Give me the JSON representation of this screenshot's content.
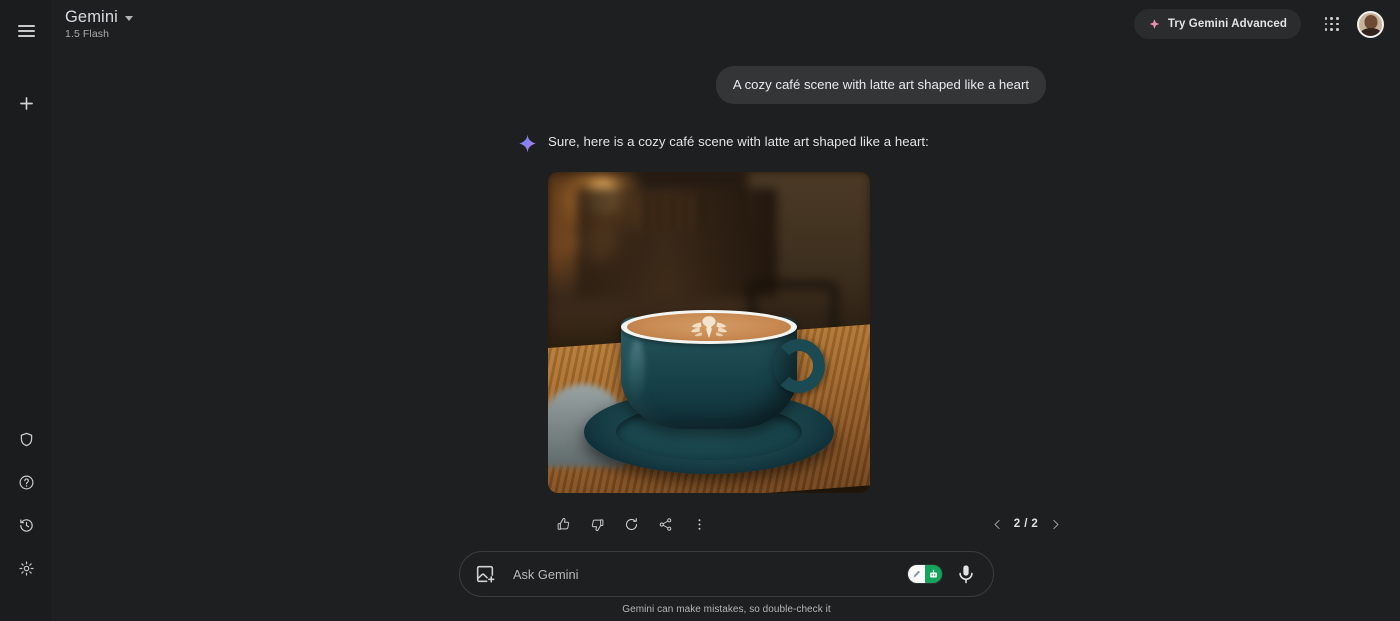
{
  "sidebar": {
    "menu_icon": "hamburger-menu-icon",
    "new_chat_icon": "plus-icon",
    "bottom_items": [
      {
        "icon": "gems-shield-icon",
        "label": "Gems"
      },
      {
        "icon": "help-circle-icon",
        "label": "Help"
      },
      {
        "icon": "history-clock-icon",
        "label": "Activity"
      },
      {
        "icon": "settings-gear-icon",
        "label": "Settings"
      }
    ]
  },
  "header": {
    "brand": "Gemini",
    "model": "1.5 Flash",
    "caret_icon": "chevron-down-icon",
    "advanced_button": {
      "label": "Try Gemini Advanced",
      "icon": "sparkle-icon",
      "icon_color": "#ef8fae"
    },
    "apps_icon": "apps-grid-icon",
    "avatar_icon": "user-avatar"
  },
  "conversation": {
    "user_message": "A cozy café scene with latte art shaped like a heart",
    "assistant_icon": "gemini-sparkle-icon",
    "assistant_text": "Sure, here is a cozy café scene with latte art shaped like a heart:",
    "image": {
      "alt": "Cozy café scene: teal cup of latte with rosetta heart latte art on a matching saucer resting on a wooden table, warm blurred café lights in the background",
      "colors": {
        "cup": "#1b4a52",
        "saucer_rim": "#f2f3ef",
        "crema": "#c88a52",
        "table_wood": "#a8702f",
        "bokeh_light": "#ffc46e",
        "background": "#2b1d11"
      }
    },
    "actions": [
      {
        "icon": "thumbs-up-icon",
        "label": "Good response"
      },
      {
        "icon": "thumbs-down-icon",
        "label": "Bad response"
      },
      {
        "icon": "regenerate-icon",
        "label": "Regenerate"
      },
      {
        "icon": "share-icon",
        "label": "Share & export"
      },
      {
        "icon": "more-vertical-icon",
        "label": "More"
      }
    ],
    "pagination": {
      "prev_icon": "chevron-left-icon",
      "next_icon": "chevron-right-icon",
      "count": "2 / 2"
    }
  },
  "composer": {
    "add_image_icon": "add-image-icon",
    "placeholder": "Ask Gemini",
    "value": "",
    "grammarly_icon_left": "pen-icon",
    "grammarly_icon_right": "robot-icon",
    "grammarly_green": "#15a45c",
    "mic_icon": "microphone-icon"
  },
  "footer": {
    "disclaimer": "Gemini can make mistakes, so double-check it"
  }
}
